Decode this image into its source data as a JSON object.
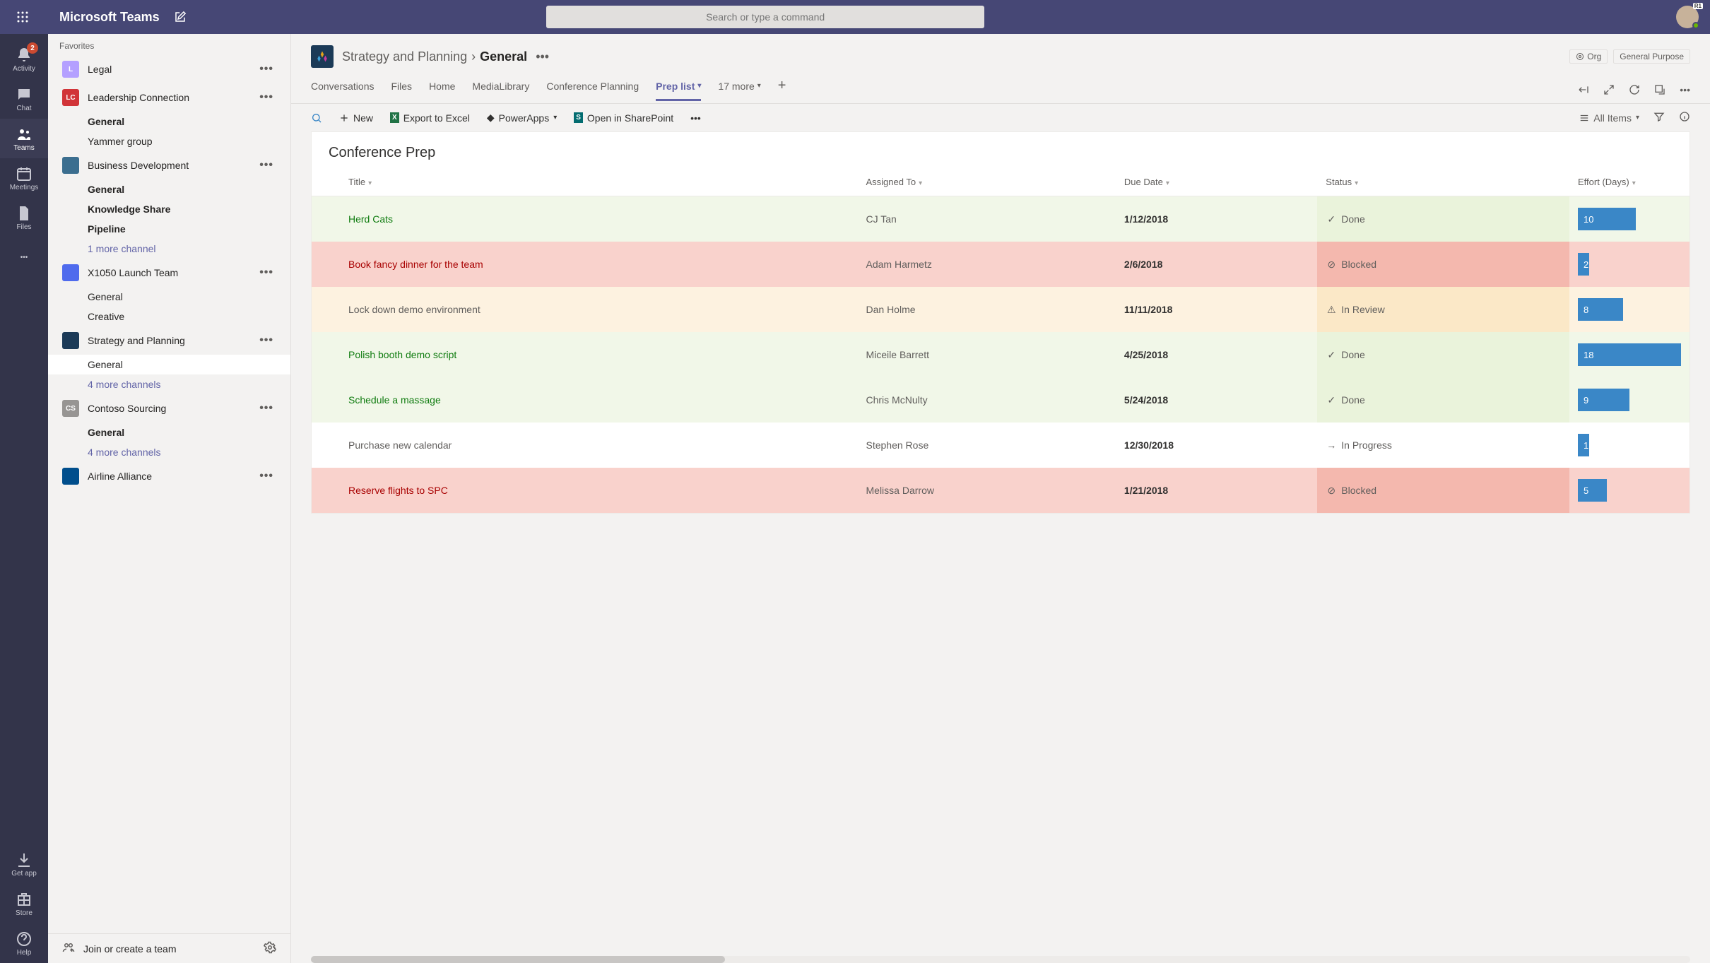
{
  "topbar": {
    "app_title": "Microsoft Teams",
    "search_placeholder": "Search or type a command",
    "avatar_flag": "R1"
  },
  "appbar": {
    "items": [
      {
        "label": "Activity",
        "badge": "2"
      },
      {
        "label": "Chat"
      },
      {
        "label": "Teams"
      },
      {
        "label": "Meetings"
      },
      {
        "label": "Files"
      },
      {
        "label": ""
      }
    ],
    "bottom": [
      {
        "label": "Get app"
      },
      {
        "label": "Store"
      },
      {
        "label": "Help"
      }
    ]
  },
  "sidebar": {
    "section": "Favorites",
    "teams": [
      {
        "initial": "L",
        "color": "#b4a0ff",
        "name": "Legal",
        "channels": []
      },
      {
        "initial": "LC",
        "color": "#d13438",
        "name": "Leadership Connection",
        "channels": [
          {
            "label": "General",
            "bold": true
          },
          {
            "label": "Yammer group",
            "bold": false
          }
        ]
      },
      {
        "initial": "",
        "color": "#3b6e8f",
        "name": "Business Development",
        "channels": [
          {
            "label": "General",
            "bold": true
          },
          {
            "label": "Knowledge Share",
            "bold": true
          },
          {
            "label": "Pipeline",
            "bold": true
          },
          {
            "label": "1 more channel",
            "link": true
          }
        ]
      },
      {
        "initial": "",
        "color": "#4f6bed",
        "name": "X1050 Launch Team",
        "channels": [
          {
            "label": "General",
            "bold": false
          },
          {
            "label": "Creative",
            "bold": false
          }
        ]
      },
      {
        "initial": "",
        "color": "#1b3a57",
        "name": "Strategy and Planning",
        "channels": [
          {
            "label": "General",
            "selected": true
          },
          {
            "label": "4 more channels",
            "link": true
          }
        ]
      },
      {
        "initial": "CS",
        "color": "#979593",
        "name": "Contoso Sourcing",
        "channels": [
          {
            "label": "General",
            "bold": true
          },
          {
            "label": "4 more channels",
            "link": true
          }
        ]
      },
      {
        "initial": "",
        "color": "#004e8c",
        "name": "Airline Alliance",
        "channels": []
      }
    ],
    "footer": "Join or create a team"
  },
  "header": {
    "team": "Strategy and Planning",
    "channel": "General",
    "right": {
      "org": "Org",
      "purpose": "General Purpose"
    }
  },
  "tabs": {
    "items": [
      "Conversations",
      "Files",
      "Home",
      "MediaLibrary",
      "Conference Planning",
      "Prep list",
      "17 more"
    ],
    "active_index": 5
  },
  "toolbar": {
    "new": "New",
    "export": "Export to Excel",
    "powerapps": "PowerApps",
    "sharepoint": "Open in SharePoint",
    "view": "All Items"
  },
  "list": {
    "title": "Conference Prep",
    "columns": [
      "Title",
      "Assigned To",
      "Due Date",
      "Status",
      "Effort (Days)"
    ],
    "rows": [
      {
        "title": "Herd Cats",
        "assigned": "CJ Tan",
        "due": "1/12/2018",
        "status": "Done",
        "effort": 10,
        "effort_pct": 56
      },
      {
        "title": "Book fancy dinner for the team",
        "assigned": "Adam Harmetz",
        "due": "2/6/2018",
        "status": "Blocked",
        "effort": 2,
        "effort_pct": 11
      },
      {
        "title": "Lock down demo environment",
        "assigned": "Dan Holme",
        "due": "11/11/2018",
        "status": "In Review",
        "effort": 8,
        "effort_pct": 44
      },
      {
        "title": "Polish booth demo script",
        "assigned": "Miceile Barrett",
        "due": "4/25/2018",
        "status": "Done",
        "effort": 18,
        "effort_pct": 100
      },
      {
        "title": "Schedule a massage",
        "assigned": "Chris McNulty",
        "due": "5/24/2018",
        "status": "Done",
        "effort": 9,
        "effort_pct": 50
      },
      {
        "title": "Purchase new calendar",
        "assigned": "Stephen Rose",
        "due": "12/30/2018",
        "status": "In Progress",
        "effort": 1,
        "effort_pct": 6
      },
      {
        "title": "Reserve flights to SPC",
        "assigned": "Melissa Darrow",
        "due": "1/21/2018",
        "status": "Blocked",
        "effort": 5,
        "effort_pct": 28
      }
    ]
  }
}
